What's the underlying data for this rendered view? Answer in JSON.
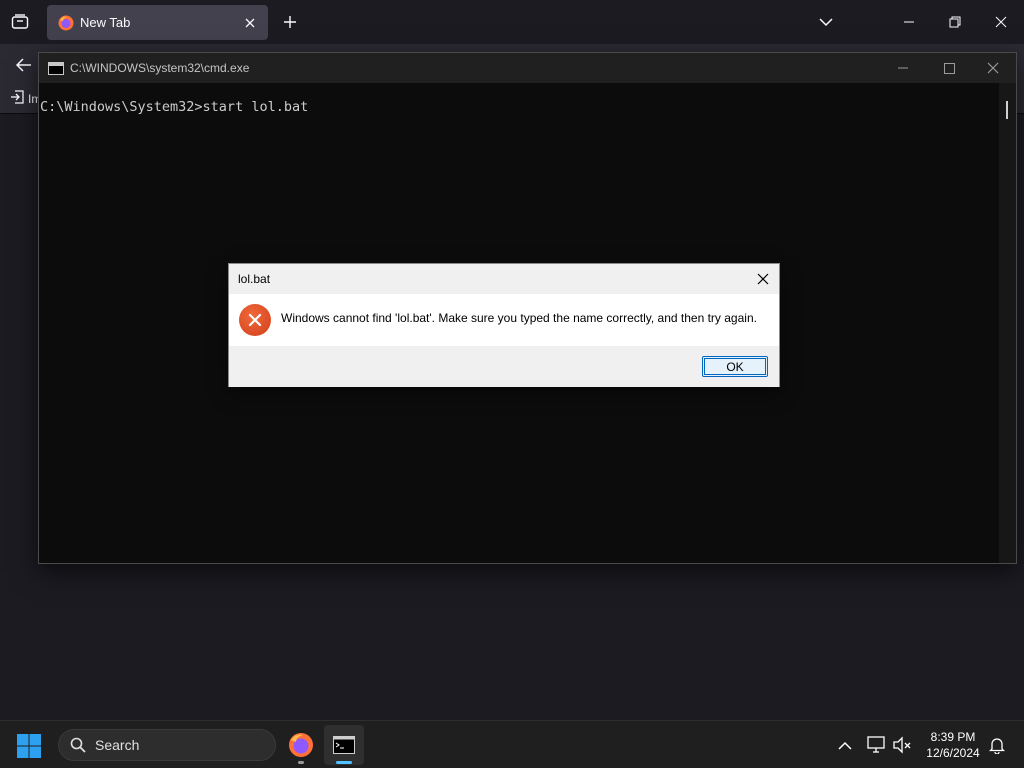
{
  "browser": {
    "tab_title": "New Tab",
    "bookmarks_import_label": "Im"
  },
  "cmd": {
    "window_title": "C:\\WINDOWS\\system32\\cmd.exe",
    "prompt_line": "C:\\Windows\\System32>start lol.bat"
  },
  "dialog": {
    "title": "lol.bat",
    "message": "Windows cannot find 'lol.bat'. Make sure you typed the name correctly, and then try again.",
    "ok_label": "OK"
  },
  "taskbar": {
    "search_label": "Search",
    "time": "8:39 PM",
    "date": "12/6/2024"
  },
  "colors": {
    "accent": "#0067c0",
    "error_icon": "#e0522a",
    "terminal_bg": "#0c0c0c",
    "browser_bg": "#1c1b22"
  },
  "icons": [
    "tab-list-icon",
    "firefox-icon",
    "tab-close-icon",
    "new-tab-icon",
    "list-all-tabs-icon",
    "minimize-icon",
    "maximize-icon",
    "restore-icon",
    "close-icon",
    "back-arrow-icon",
    "import-icon",
    "cmd-icon",
    "error-icon",
    "windows-start-icon",
    "search-icon",
    "terminal-icon",
    "chevron-up-icon",
    "network-icon",
    "volume-muted-icon",
    "notification-bell-icon"
  ]
}
